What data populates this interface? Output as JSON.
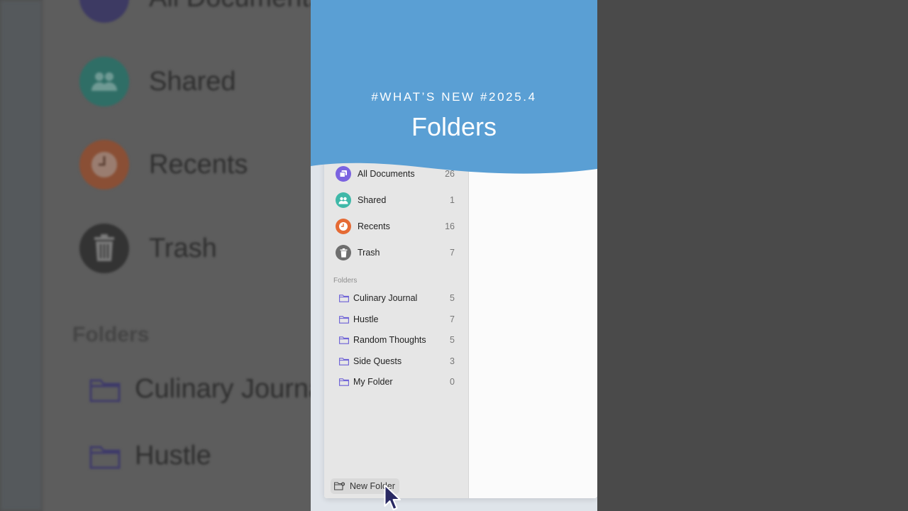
{
  "banner": {
    "tag": "#WHAT’S NEW #2025.4",
    "title": "Folders",
    "color": "#5a9fd4"
  },
  "sidebar": {
    "items": [
      {
        "label": "All Documents",
        "count": "26",
        "icon": "documents-icon",
        "color": "#7b63e0"
      },
      {
        "label": "Shared",
        "count": "1",
        "icon": "people-icon",
        "color": "#3fb8a8"
      },
      {
        "label": "Recents",
        "count": "16",
        "icon": "clock-icon",
        "color": "#e56a34"
      },
      {
        "label": "Trash",
        "count": "7",
        "icon": "trash-icon",
        "color": "#6e6e6e"
      }
    ],
    "section_label": "Folders",
    "folders": [
      {
        "label": "Culinary Journal",
        "count": "5"
      },
      {
        "label": "Hustle",
        "count": "7"
      },
      {
        "label": "Random Thoughts",
        "count": "5"
      },
      {
        "label": "Side Quests",
        "count": "3"
      },
      {
        "label": "My Folder",
        "count": "0"
      }
    ],
    "new_folder_label": "New Folder",
    "folder_icon_color": "#6b5fd6"
  },
  "background": {
    "items": [
      {
        "label": "All Documents"
      },
      {
        "label": "Shared"
      },
      {
        "label": "Recents"
      },
      {
        "label": "Trash"
      }
    ],
    "section_label": "Folders",
    "folders": [
      {
        "label": "Culinary Journal"
      },
      {
        "label": "Hustle"
      }
    ]
  }
}
